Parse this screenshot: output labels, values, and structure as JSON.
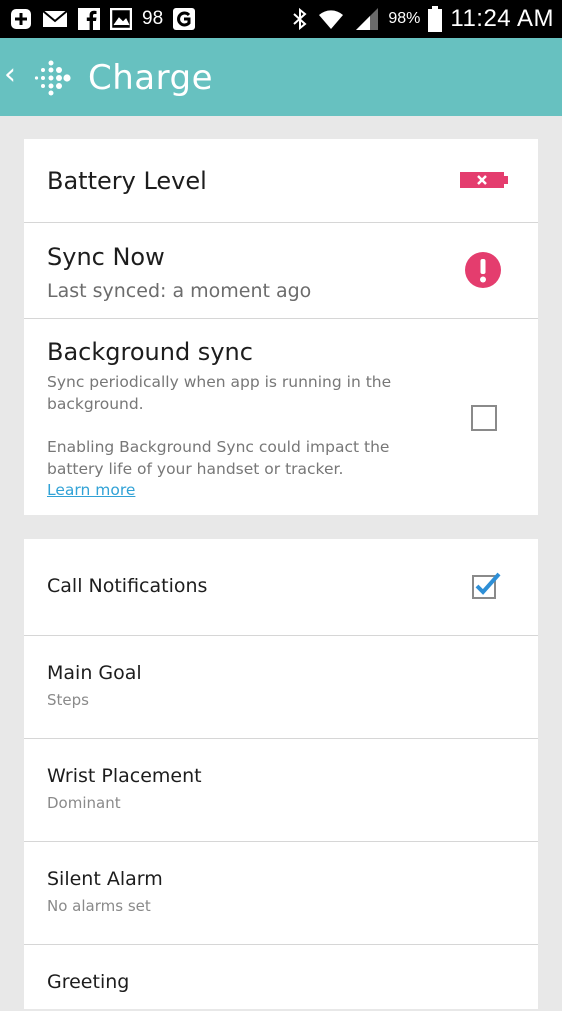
{
  "status_bar": {
    "left_icons": [
      "plus-box-icon",
      "mail-icon",
      "facebook-icon",
      "gallery-icon"
    ],
    "temperature": "98",
    "g_icon": "g-icon",
    "right_icons": [
      "bluetooth-icon",
      "wifi-icon",
      "signal-icon",
      "battery-icon"
    ],
    "battery_percent": "98%",
    "time": "11:24 AM"
  },
  "app_bar": {
    "back_icon": "chevron-left-icon",
    "logo": "fitbit-logo-icon",
    "title": "Charge",
    "color": "#67c1c0"
  },
  "device_card": {
    "battery": {
      "label": "Battery Level",
      "icon": "battery-empty-icon",
      "level": 0,
      "color": "#e43d6e"
    },
    "sync": {
      "label": "Sync Now",
      "sub": "Last synced: a moment ago",
      "icon": "alert-icon",
      "color": "#e43d6e"
    },
    "background_sync": {
      "label": "Background sync",
      "desc1": "Sync periodically when app is running in the background.",
      "desc2": "Enabling Background Sync could impact the battery life of your handset or tracker.",
      "link": "Learn more",
      "checked": false
    }
  },
  "settings_card": {
    "call_notifications": {
      "label": "Call Notifications",
      "checked": true,
      "check_color": "#2e8fd6"
    },
    "main_goal": {
      "label": "Main Goal",
      "value": "Steps"
    },
    "wrist_placement": {
      "label": "Wrist Placement",
      "value": "Dominant"
    },
    "silent_alarm": {
      "label": "Silent Alarm",
      "value": "No alarms set"
    },
    "greeting": {
      "label": "Greeting"
    }
  }
}
